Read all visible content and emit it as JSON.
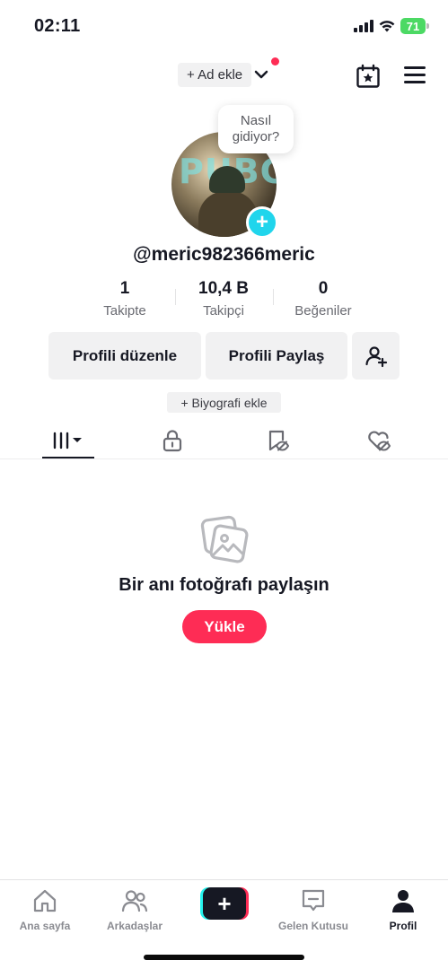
{
  "status_bar": {
    "time": "02:11",
    "battery": "71"
  },
  "header": {
    "add_name_label": "+ Ad ekle"
  },
  "avatar": {
    "overlay_text": "PUBG",
    "bubble_text_1": "Nasıl",
    "bubble_text_2": "gidiyor?"
  },
  "profile": {
    "username": "@meric982366meric"
  },
  "stats": [
    {
      "value": "1",
      "label": "Takipte"
    },
    {
      "value": "10,4 B",
      "label": "Takipçi"
    },
    {
      "value": "0",
      "label": "Beğeniler"
    }
  ],
  "actions": {
    "edit_profile": "Profili düzenle",
    "share_profile": "Profili Paylaş",
    "bio_add": "+ Biyografi ekle"
  },
  "tabs": [
    "videos-grid-icon",
    "lock-icon",
    "bookmark-eye-icon",
    "heart-eye-icon"
  ],
  "empty_state": {
    "title": "Bir anı fotoğrafı paylaşın",
    "upload_label": "Yükle"
  },
  "bottom_nav": [
    {
      "label": "Ana sayfa"
    },
    {
      "label": "Arkadaşlar"
    },
    {
      "label": "Gelen Kutusu"
    },
    {
      "label": "Profil"
    }
  ],
  "colors": {
    "accent": "#fe2c55",
    "cyan": "#20d5ec",
    "pill_bg": "#f1f1f2",
    "text": "#161823",
    "muted": "#6a6b72"
  }
}
